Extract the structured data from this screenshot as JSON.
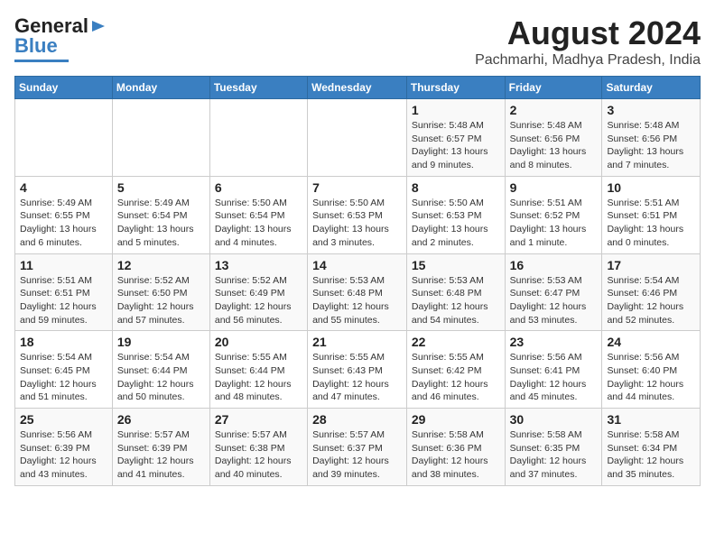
{
  "header": {
    "logo_line1": "General",
    "logo_line2": "Blue",
    "month_year": "August 2024",
    "location": "Pachmarhi, Madhya Pradesh, India"
  },
  "days_of_week": [
    "Sunday",
    "Monday",
    "Tuesday",
    "Wednesday",
    "Thursday",
    "Friday",
    "Saturday"
  ],
  "weeks": [
    [
      {
        "day": "",
        "info": ""
      },
      {
        "day": "",
        "info": ""
      },
      {
        "day": "",
        "info": ""
      },
      {
        "day": "",
        "info": ""
      },
      {
        "day": "1",
        "info": "Sunrise: 5:48 AM\nSunset: 6:57 PM\nDaylight: 13 hours\nand 9 minutes."
      },
      {
        "day": "2",
        "info": "Sunrise: 5:48 AM\nSunset: 6:56 PM\nDaylight: 13 hours\nand 8 minutes."
      },
      {
        "day": "3",
        "info": "Sunrise: 5:48 AM\nSunset: 6:56 PM\nDaylight: 13 hours\nand 7 minutes."
      }
    ],
    [
      {
        "day": "4",
        "info": "Sunrise: 5:49 AM\nSunset: 6:55 PM\nDaylight: 13 hours\nand 6 minutes."
      },
      {
        "day": "5",
        "info": "Sunrise: 5:49 AM\nSunset: 6:54 PM\nDaylight: 13 hours\nand 5 minutes."
      },
      {
        "day": "6",
        "info": "Sunrise: 5:50 AM\nSunset: 6:54 PM\nDaylight: 13 hours\nand 4 minutes."
      },
      {
        "day": "7",
        "info": "Sunrise: 5:50 AM\nSunset: 6:53 PM\nDaylight: 13 hours\nand 3 minutes."
      },
      {
        "day": "8",
        "info": "Sunrise: 5:50 AM\nSunset: 6:53 PM\nDaylight: 13 hours\nand 2 minutes."
      },
      {
        "day": "9",
        "info": "Sunrise: 5:51 AM\nSunset: 6:52 PM\nDaylight: 13 hours\nand 1 minute."
      },
      {
        "day": "10",
        "info": "Sunrise: 5:51 AM\nSunset: 6:51 PM\nDaylight: 13 hours\nand 0 minutes."
      }
    ],
    [
      {
        "day": "11",
        "info": "Sunrise: 5:51 AM\nSunset: 6:51 PM\nDaylight: 12 hours\nand 59 minutes."
      },
      {
        "day": "12",
        "info": "Sunrise: 5:52 AM\nSunset: 6:50 PM\nDaylight: 12 hours\nand 57 minutes."
      },
      {
        "day": "13",
        "info": "Sunrise: 5:52 AM\nSunset: 6:49 PM\nDaylight: 12 hours\nand 56 minutes."
      },
      {
        "day": "14",
        "info": "Sunrise: 5:53 AM\nSunset: 6:48 PM\nDaylight: 12 hours\nand 55 minutes."
      },
      {
        "day": "15",
        "info": "Sunrise: 5:53 AM\nSunset: 6:48 PM\nDaylight: 12 hours\nand 54 minutes."
      },
      {
        "day": "16",
        "info": "Sunrise: 5:53 AM\nSunset: 6:47 PM\nDaylight: 12 hours\nand 53 minutes."
      },
      {
        "day": "17",
        "info": "Sunrise: 5:54 AM\nSunset: 6:46 PM\nDaylight: 12 hours\nand 52 minutes."
      }
    ],
    [
      {
        "day": "18",
        "info": "Sunrise: 5:54 AM\nSunset: 6:45 PM\nDaylight: 12 hours\nand 51 minutes."
      },
      {
        "day": "19",
        "info": "Sunrise: 5:54 AM\nSunset: 6:44 PM\nDaylight: 12 hours\nand 50 minutes."
      },
      {
        "day": "20",
        "info": "Sunrise: 5:55 AM\nSunset: 6:44 PM\nDaylight: 12 hours\nand 48 minutes."
      },
      {
        "day": "21",
        "info": "Sunrise: 5:55 AM\nSunset: 6:43 PM\nDaylight: 12 hours\nand 47 minutes."
      },
      {
        "day": "22",
        "info": "Sunrise: 5:55 AM\nSunset: 6:42 PM\nDaylight: 12 hours\nand 46 minutes."
      },
      {
        "day": "23",
        "info": "Sunrise: 5:56 AM\nSunset: 6:41 PM\nDaylight: 12 hours\nand 45 minutes."
      },
      {
        "day": "24",
        "info": "Sunrise: 5:56 AM\nSunset: 6:40 PM\nDaylight: 12 hours\nand 44 minutes."
      }
    ],
    [
      {
        "day": "25",
        "info": "Sunrise: 5:56 AM\nSunset: 6:39 PM\nDaylight: 12 hours\nand 43 minutes."
      },
      {
        "day": "26",
        "info": "Sunrise: 5:57 AM\nSunset: 6:39 PM\nDaylight: 12 hours\nand 41 minutes."
      },
      {
        "day": "27",
        "info": "Sunrise: 5:57 AM\nSunset: 6:38 PM\nDaylight: 12 hours\nand 40 minutes."
      },
      {
        "day": "28",
        "info": "Sunrise: 5:57 AM\nSunset: 6:37 PM\nDaylight: 12 hours\nand 39 minutes."
      },
      {
        "day": "29",
        "info": "Sunrise: 5:58 AM\nSunset: 6:36 PM\nDaylight: 12 hours\nand 38 minutes."
      },
      {
        "day": "30",
        "info": "Sunrise: 5:58 AM\nSunset: 6:35 PM\nDaylight: 12 hours\nand 37 minutes."
      },
      {
        "day": "31",
        "info": "Sunrise: 5:58 AM\nSunset: 6:34 PM\nDaylight: 12 hours\nand 35 minutes."
      }
    ]
  ]
}
